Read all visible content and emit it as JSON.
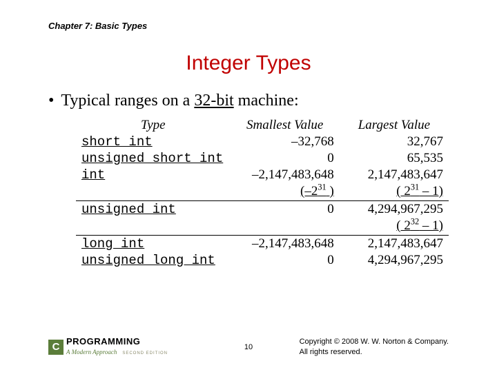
{
  "chapter": "Chapter 7: Basic Types",
  "title": "Integer Types",
  "bullet_prefix": "Typical ranges on a ",
  "bullet_bits": "32-bit",
  "bullet_suffix": " machine:",
  "headers": {
    "type": "Type",
    "smallest": "Smallest Value",
    "largest": "Largest Value"
  },
  "rows": {
    "r1": {
      "type": "short int",
      "sv": "–32,768",
      "lv": "32,767"
    },
    "r2": {
      "type": "unsigned short int",
      "sv": "0",
      "lv": "65,535"
    },
    "r3": {
      "type": "int",
      "sv": "–2,147,483,648",
      "lv": "2,147,483,647"
    },
    "r3e": {
      "sv_pre": "(–2",
      "sv_exp": "31",
      "sv_post": " )",
      "lv_pre": "( 2",
      "lv_exp": "31",
      "lv_post": " – 1)"
    },
    "r4": {
      "type": "unsigned int",
      "sv": "0",
      "lv": "4,294,967,295"
    },
    "r4e": {
      "lv_pre": "( 2",
      "lv_exp": "32",
      "lv_post": " – 1)"
    },
    "r5": {
      "type": "long int",
      "sv": "–2,147,483,648",
      "lv": "2,147,483,647"
    },
    "r6": {
      "type": "unsigned long int",
      "sv": "0",
      "lv": "4,294,967,295"
    }
  },
  "chart_data": {
    "type": "table",
    "title": "Integer type ranges on a 32-bit machine",
    "columns": [
      "Type",
      "Smallest Value",
      "Largest Value"
    ],
    "rows": [
      [
        "short int",
        -32768,
        32767
      ],
      [
        "unsigned short int",
        0,
        65535
      ],
      [
        "int",
        -2147483648,
        2147483647
      ],
      [
        "unsigned int",
        0,
        4294967295
      ],
      [
        "long int",
        -2147483648,
        2147483647
      ],
      [
        "unsigned long int",
        0,
        4294967295
      ]
    ],
    "annotations": [
      "int smallest = -2^31, int largest = 2^31 - 1",
      "unsigned int largest = 2^32 - 1"
    ]
  },
  "logo": {
    "c": "C",
    "word": "PROGRAMMING",
    "sub": "A Modern Approach",
    "edition": "SECOND EDITION"
  },
  "page": "10",
  "copyright1": "Copyright © 2008 W. W. Norton & Company.",
  "copyright2": "All rights reserved."
}
